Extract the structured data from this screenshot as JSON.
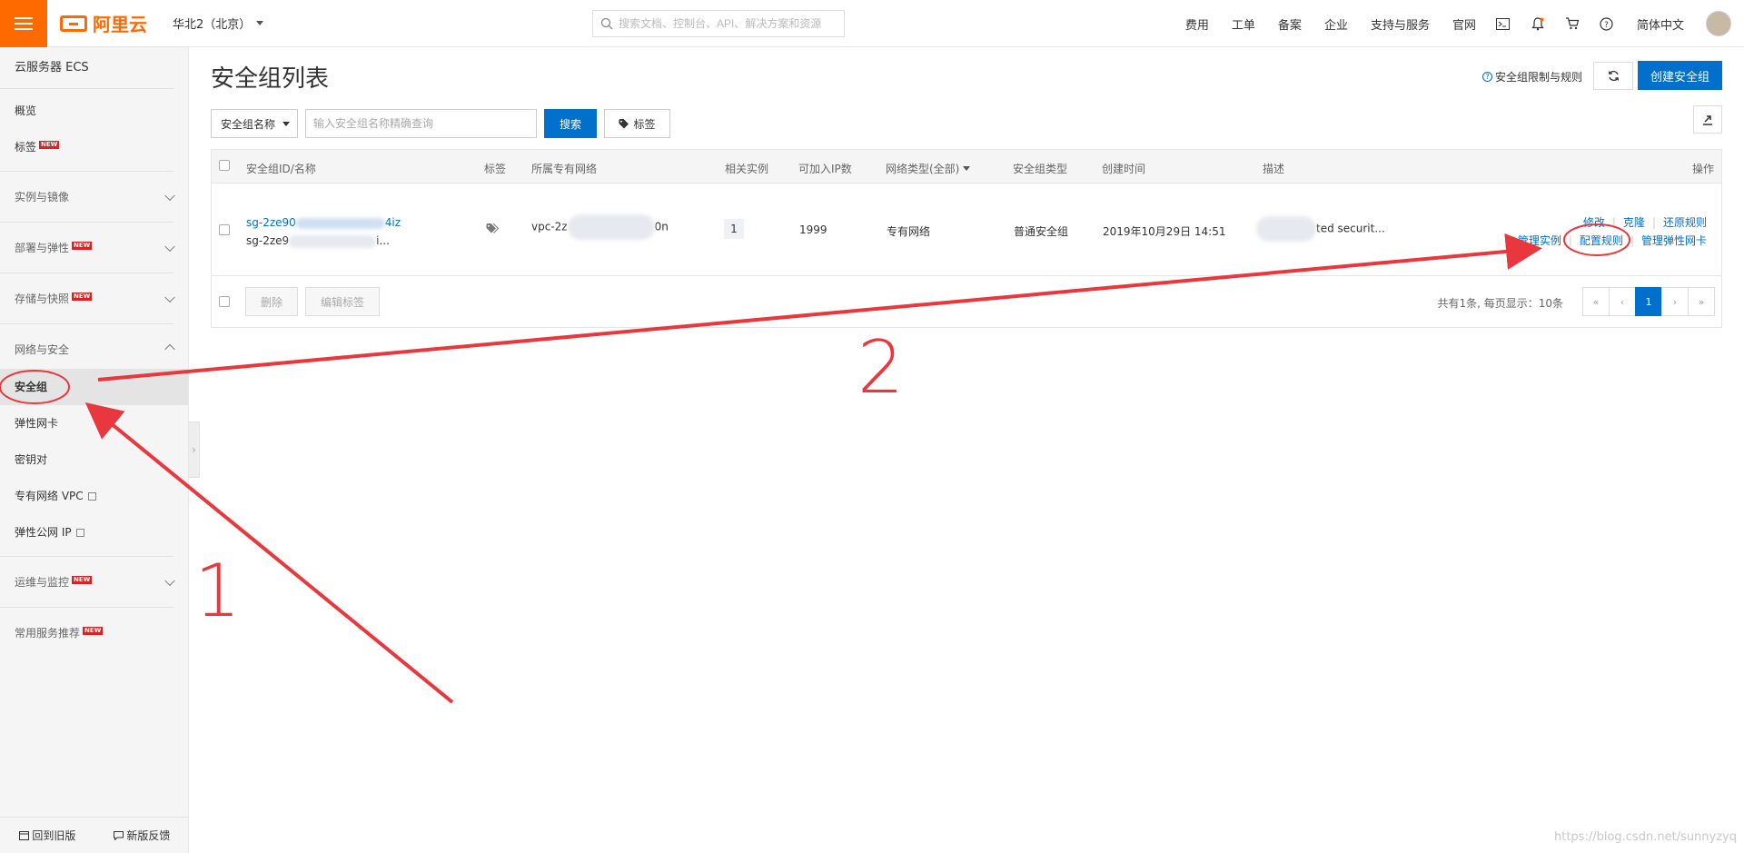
{
  "header": {
    "logo_text": "阿里云",
    "region": "华北2（北京）",
    "search_placeholder": "搜索文档、控制台、API、解决方案和资源",
    "nav_links": [
      "费用",
      "工单",
      "备案",
      "企业",
      "支持与服务",
      "官网"
    ],
    "language": "简体中文",
    "icons": [
      "terminal-icon",
      "bell-icon",
      "cart-icon",
      "help-icon"
    ]
  },
  "sidebar": {
    "title": "云服务器 ECS",
    "overview": "概览",
    "tags": "标签",
    "new_badge": "NEW",
    "groups": {
      "instances": "实例与镜像",
      "deploy": "部署与弹性",
      "storage": "存储与快照",
      "network": "网络与安全",
      "ops": "运维与监控",
      "common": "常用服务推荐"
    },
    "network_items": {
      "security_group": "安全组",
      "eni": "弹性网卡",
      "keypair": "密钥对",
      "vpc": "专有网络 VPC",
      "eip": "弹性公网 IP"
    },
    "footer": {
      "back_old": "回到旧版",
      "feedback": "新版反馈"
    }
  },
  "main": {
    "title": "安全组列表",
    "help_link": "安全组限制与规则",
    "create_button": "创建安全组",
    "filter": {
      "select_value": "安全组名称",
      "input_placeholder": "输入安全组名称精确查询",
      "search_button": "搜索",
      "tag_button": "标签"
    },
    "table": {
      "headers": {
        "id_name": "安全组ID/名称",
        "tag": "标签",
        "vpc": "所属专有网络",
        "instances": "相关实例",
        "ip_count": "可加入IP数",
        "net_type": "网络类型(全部)",
        "sg_type": "安全组类型",
        "created": "创建时间",
        "desc": "描述",
        "ops": "操作"
      },
      "row": {
        "id_prefix": "sg-2ze90",
        "id_suffix": "4iz",
        "name_prefix": "sg-2ze9",
        "name_suffix": "i...",
        "vpc_prefix": "vpc-2z",
        "vpc_suffix": "0n",
        "instances": "1",
        "ip_count": "1999",
        "net_type": "专有网络",
        "sg_type": "普通安全组",
        "created": "2019年10月29日 14:51",
        "desc_suffix": "ted securit...",
        "ops": {
          "modify": "修改",
          "clone": "克隆",
          "restore": "还原规则",
          "manage_instances": "管理实例",
          "config_rules": "配置规则",
          "manage_eni": "管理弹性网卡"
        }
      }
    },
    "footer": {
      "delete": "删除",
      "edit_tags": "编辑标签",
      "pager_info": "共有1条, 每页显示：10条",
      "pages": [
        "«",
        "‹",
        "1",
        "›",
        "»"
      ],
      "current_page": "1"
    }
  },
  "annotations": {
    "step1": "1",
    "step2": "2",
    "color": "#e8383d"
  },
  "watermark": "https://blog.csdn.net/sunnyzyq"
}
